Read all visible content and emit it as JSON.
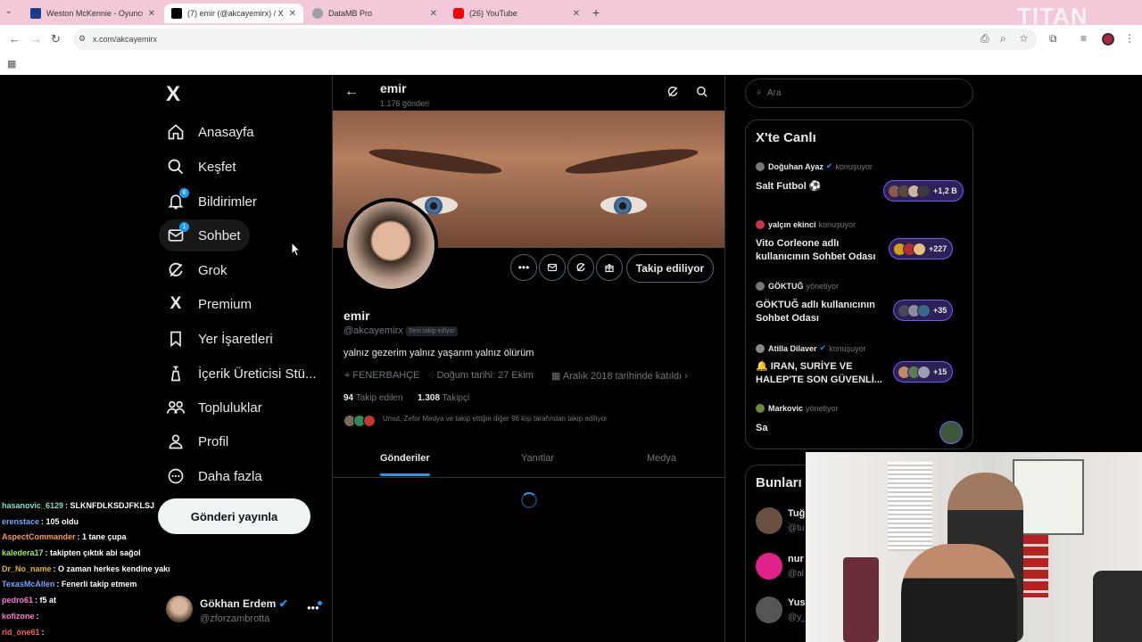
{
  "browser": {
    "tabs": [
      {
        "title": "Weston McKennie - Oyuncu pr",
        "favicon_color": "#1e3a8a",
        "active": false
      },
      {
        "title": "(7) emir (@akcayemirx) / X",
        "favicon_color": "#000000",
        "active": true
      },
      {
        "title": "DataMB Pro",
        "favicon_color": "#9aa0a6",
        "active": false
      },
      {
        "title": "(26) YouTube",
        "favicon_color": "#ff0000",
        "active": false
      }
    ],
    "url": "x.com/akcayemirx",
    "watermark": "TITAN"
  },
  "sidebar": {
    "logo": "X",
    "items": [
      {
        "label": "Anasayfa",
        "icon": "home-icon"
      },
      {
        "label": "Keşfet",
        "icon": "search-icon"
      },
      {
        "label": "Bildirimler",
        "icon": "bell-icon",
        "badge": "6"
      },
      {
        "label": "Sohbet",
        "icon": "mail-icon",
        "badge": "1"
      },
      {
        "label": "Grok",
        "icon": "grok-icon"
      },
      {
        "label": "Premium",
        "icon": "x-icon"
      },
      {
        "label": "Yer İşaretleri",
        "icon": "bookmark-icon"
      },
      {
        "label": "İçerik Üreticisi Stü...",
        "icon": "creator-studio-icon"
      },
      {
        "label": "Topluluklar",
        "icon": "communities-icon"
      },
      {
        "label": "Profil",
        "icon": "user-icon"
      },
      {
        "label": "Daha fazla",
        "icon": "more-circle-icon"
      }
    ],
    "post_button": "Gönderi yayınla",
    "account": {
      "name": "Gökhan Erdem",
      "handle": "@zforzambrotta"
    }
  },
  "chat": [
    {
      "user": "hasanovic_6129",
      "message": ": SLKNFDLKSDJFKLSJ",
      "color": "#7ee0c7"
    },
    {
      "user": "erenstace",
      "message": ": 105 oldu",
      "color": "#6ea8ff"
    },
    {
      "user": "AspectCommander",
      "message": ": 1 tane çupa",
      "color": "#ff9a3c"
    },
    {
      "user": "kaledera17",
      "message": ": takipten çıktık abi sağol",
      "color": "#a0e85a"
    },
    {
      "user": "Dr_No_name",
      "message": ": O zaman herkes kendine yakışanı yapsın :D",
      "color": "#e6b800"
    },
    {
      "user": "TexasMcAllen",
      "message": ": Fenerli takip etmem",
      "color": "#6ea8ff"
    },
    {
      "user": "pedro61",
      "message": ": f5 at",
      "color": "#ff7ad9"
    },
    {
      "user": "kofizone",
      "message": ":",
      "color": "#ff7ad9"
    },
    {
      "user": "rid_one61",
      "message": ":",
      "color": "#ff5a5a"
    }
  ],
  "profile": {
    "header_name": "emir",
    "post_count": "1.176 gönderi",
    "name": "emir",
    "handle": "@akcayemirx",
    "follows_you": "Seni takip ediyor",
    "bio": "yalnız gezerim yalnız yaşarım yalnız ölürüm",
    "location": "FENERBAHÇE",
    "birthday": "Doğum tarihi: 27 Ekim",
    "joined": "Aralık 2018 tarihinde katıldı",
    "following_count": "94",
    "following_label": "Takip edilen",
    "followers_count": "1.308",
    "followers_label": "Takipçi",
    "mutuals": "Umut, Zefor Medya ve takip ettiğin diğer 96 kişi tarafından takip ediliyor",
    "follow_button": "Takip ediliyor",
    "tabs": [
      "Gönderiler",
      "Yanıtlar",
      "Medya"
    ],
    "active_tab": "Gönderiler"
  },
  "right": {
    "search_placeholder": "Ara",
    "live_title": "X'te Canlı",
    "spaces": [
      {
        "host": "Doğuhan Ayaz",
        "verified": true,
        "role": "konuşuyor",
        "title": "Salt Futbol ⚽",
        "listeners": "+1,2 B",
        "dot": "#777777"
      },
      {
        "host": "yalçın ekinci",
        "verified": false,
        "role": "konuşuyor",
        "title": "Vito Corleone adlı kullanıcının Sohbet Odası",
        "listeners": "+227",
        "dot": "#cc3344"
      },
      {
        "host": "GÖKTUĞ",
        "verified": false,
        "role": "yönetiyor",
        "title": "GÖKTUĞ adlı kullanıcının Sohbet Odası",
        "listeners": "+35",
        "dot": "#777777"
      },
      {
        "host": "Atilla Dilaver",
        "verified": true,
        "role": "konuşuyor",
        "title": "🔔 IRAN, SURİYE VE HALEP'TE SON GÜVENLİ...",
        "listeners": "+15",
        "dot": "#888888"
      },
      {
        "host": "Markovic",
        "verified": false,
        "role": "yönetiyor",
        "title": "Sa",
        "listeners": "",
        "dot": "#6a8a3a"
      }
    ],
    "who_title": "Bunları",
    "who": [
      {
        "name": "Tuğ",
        "handle": "@tu"
      },
      {
        "name": "nur",
        "handle": "@al"
      },
      {
        "name": "Yus",
        "handle": "@y_"
      }
    ]
  }
}
